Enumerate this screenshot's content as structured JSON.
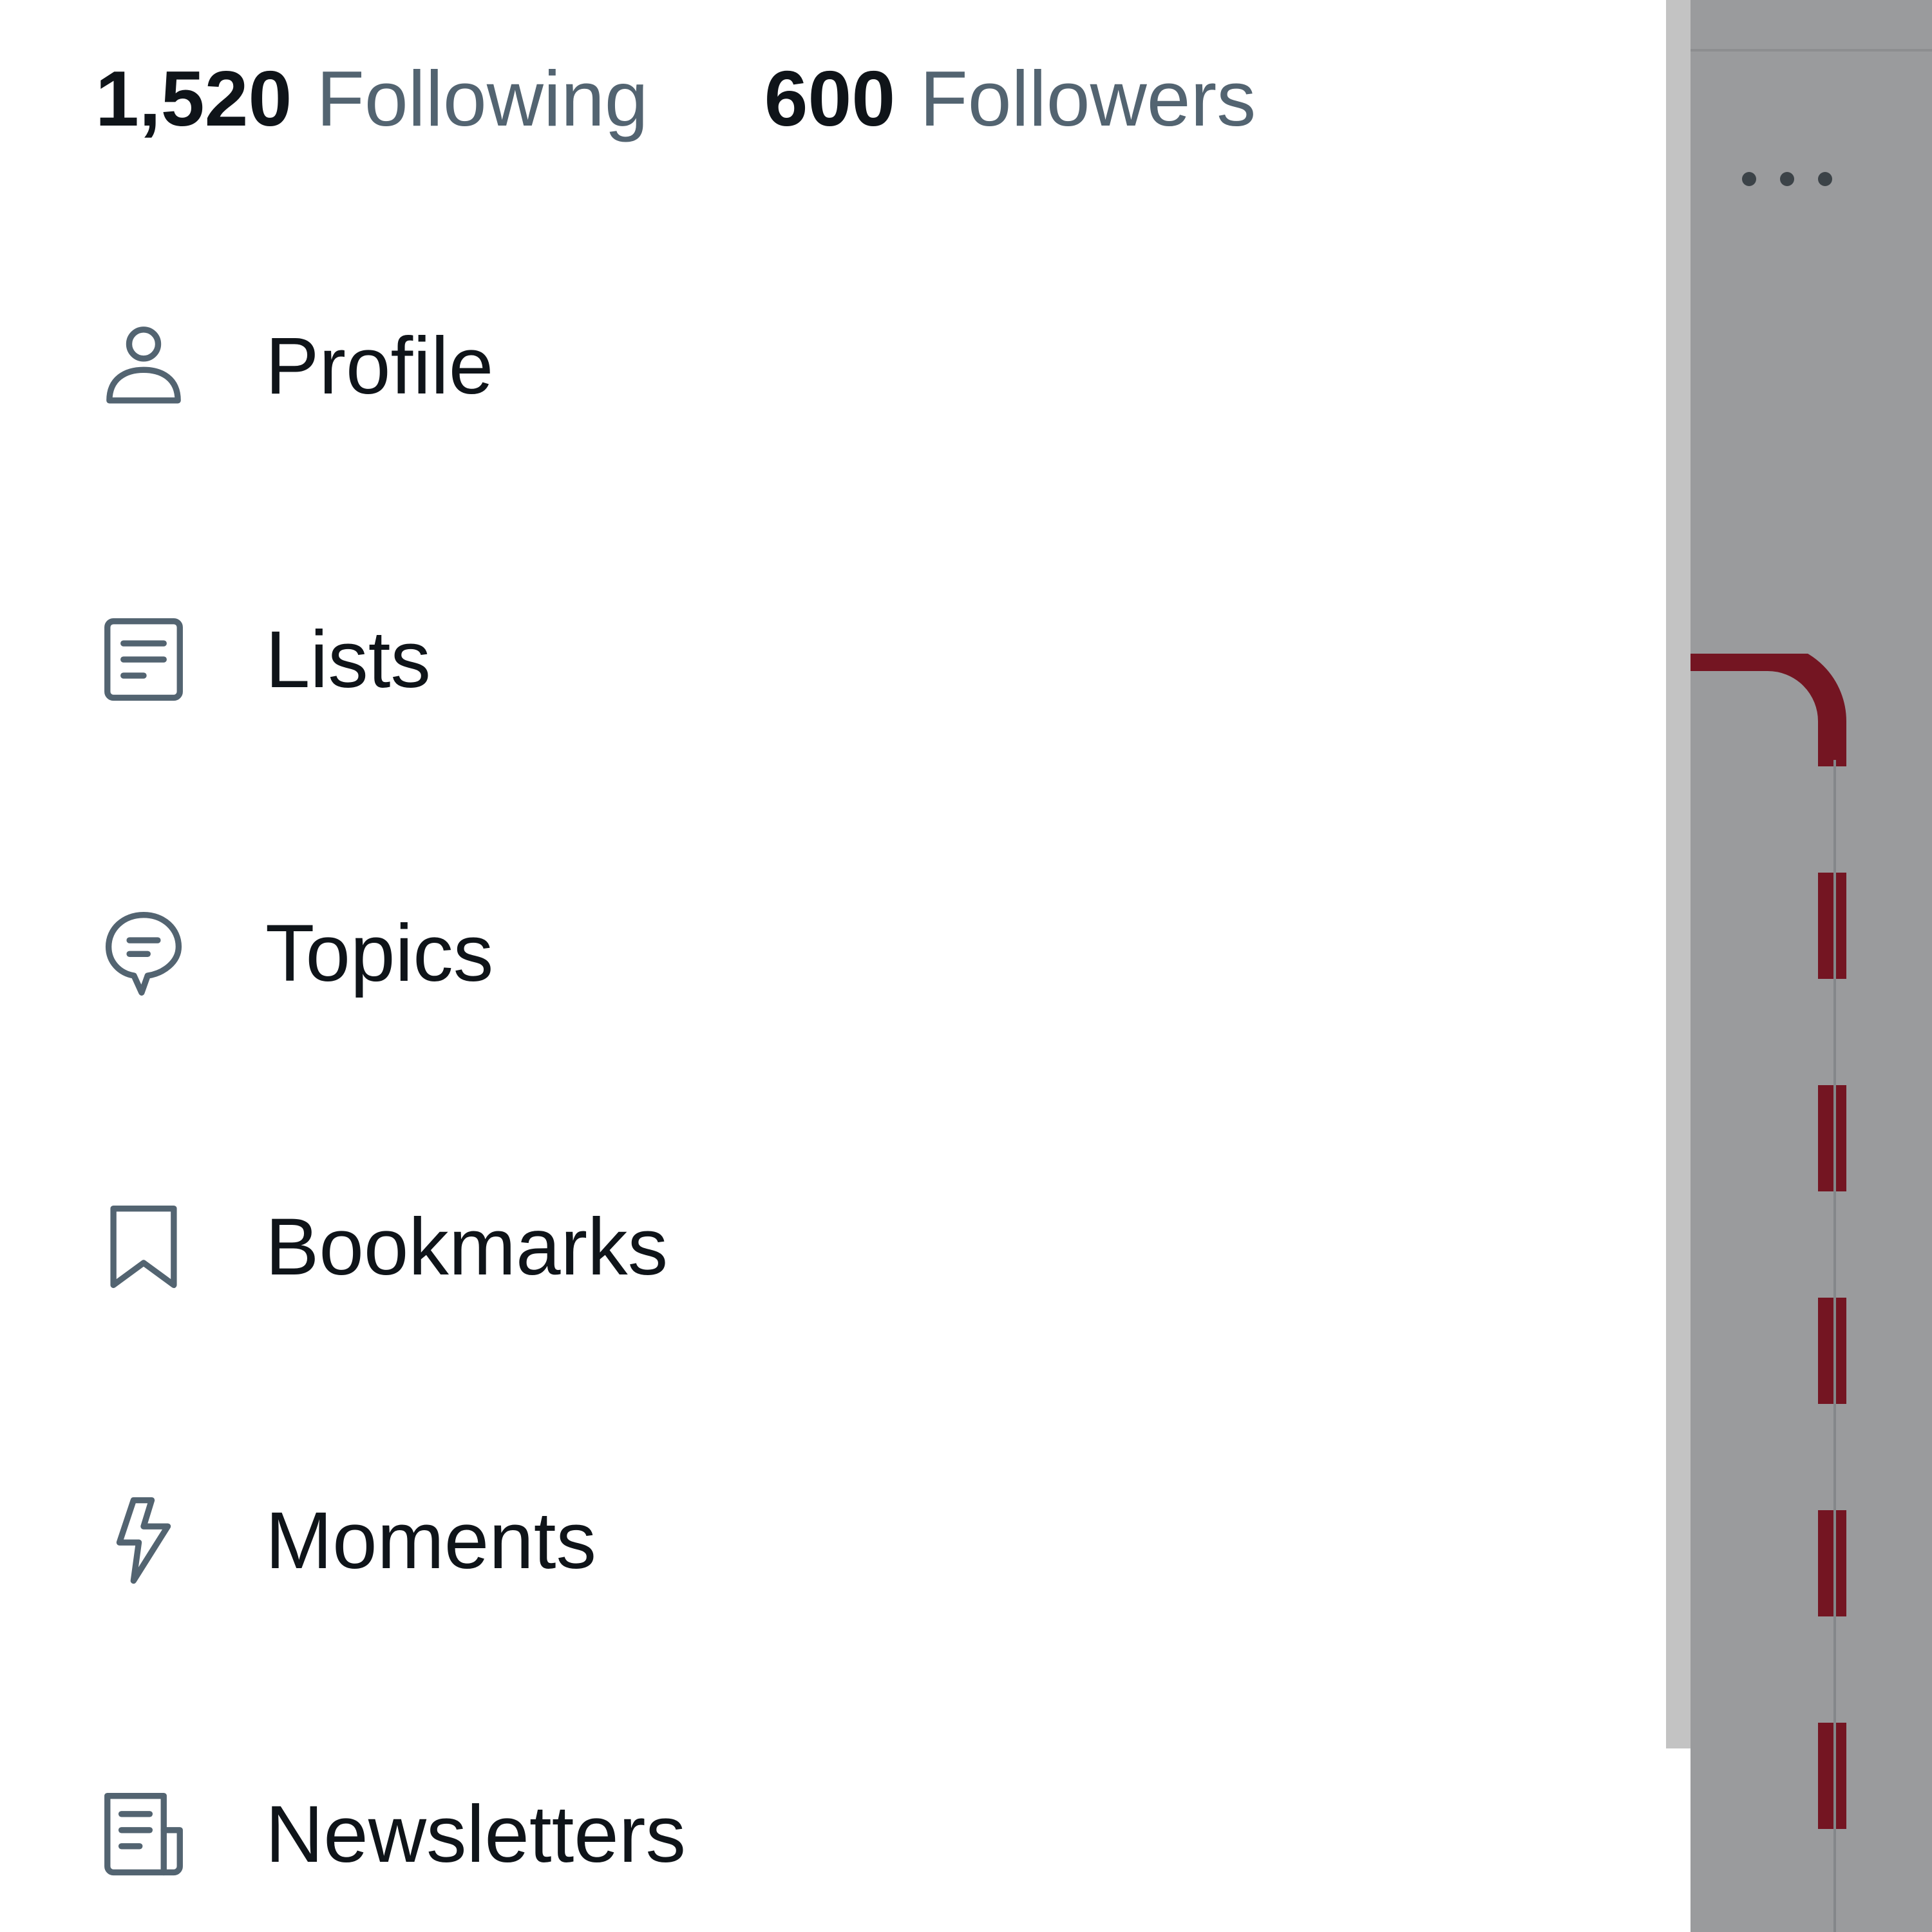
{
  "stats": {
    "following_count": "1,520",
    "following_label": "Following",
    "followers_count": "600",
    "followers_label": "Followers"
  },
  "menu": {
    "items": [
      {
        "label": "Profile",
        "icon": "person-icon"
      },
      {
        "label": "Lists",
        "icon": "list-icon"
      },
      {
        "label": "Topics",
        "icon": "topics-icon"
      },
      {
        "label": "Bookmarks",
        "icon": "bookmark-icon"
      },
      {
        "label": "Moments",
        "icon": "lightning-icon"
      },
      {
        "label": "Newsletters",
        "icon": "newsletter-icon"
      }
    ]
  },
  "colors": {
    "primary_text": "#0f1419",
    "secondary_text": "#536471",
    "overlay": "#9a9b9d",
    "accent_card": "#7a1420"
  }
}
